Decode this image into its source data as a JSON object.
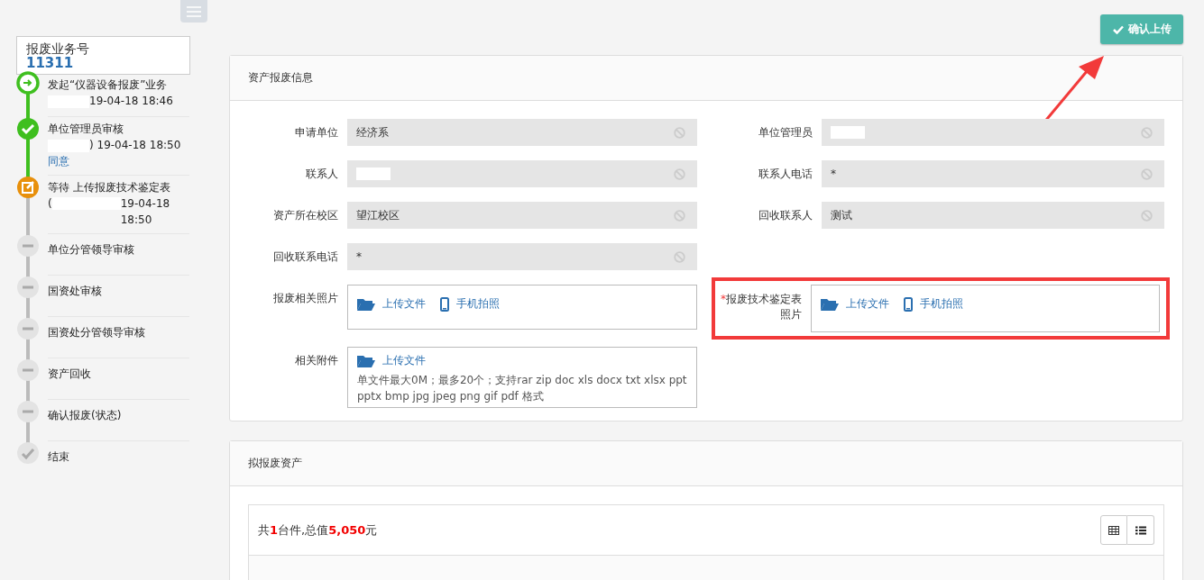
{
  "case": {
    "label": "报废业务号",
    "number": "11311"
  },
  "steps": [
    {
      "kind": "start",
      "title": "发起“仪器设备报废”业务",
      "redacted": true,
      "detail": "19-04-18 18:46"
    },
    {
      "kind": "done",
      "title": "单位管理员审核",
      "redacted": true,
      "detail": ") 19-04-18 18:50",
      "result": "同意"
    },
    {
      "kind": "current",
      "title": "等待 上传报废技术鉴定表",
      "prefix": "(",
      "redacted": true,
      "detail": "19-04-18 18:50"
    },
    {
      "kind": "pending",
      "title": "单位分管领导审核"
    },
    {
      "kind": "pending",
      "title": "国资处审核"
    },
    {
      "kind": "pending",
      "title": "国资处分管领导审核"
    },
    {
      "kind": "pending",
      "title": "资产回收"
    },
    {
      "kind": "pending",
      "title": "确认报废(状态)"
    },
    {
      "kind": "end",
      "title": "结束"
    }
  ],
  "confirm_button": {
    "label": "确认上传"
  },
  "annotation": {
    "arrow_to_button": true
  },
  "info_panel": {
    "title": "资产报废信息",
    "rows": [
      [
        {
          "kind": "text",
          "label": "申请单位",
          "value": "经济系",
          "disabled": true
        },
        {
          "kind": "text",
          "label": "单位管理员",
          "redacted": true,
          "disabled": true
        }
      ],
      [
        {
          "kind": "text",
          "label": "联系人",
          "redacted": true,
          "disabled": true
        },
        {
          "kind": "text",
          "label": "联系人电话",
          "value": "*",
          "disabled": true
        }
      ],
      [
        {
          "kind": "text",
          "label": "资产所在校区",
          "value": "望江校区",
          "disabled": true
        },
        {
          "kind": "text",
          "label": "回收联系人",
          "value": "测试",
          "disabled": true
        }
      ],
      [
        {
          "kind": "text",
          "label": "回收联系电话",
          "value": "*",
          "disabled": true
        }
      ],
      [
        {
          "kind": "upload",
          "label": "报废相关照片",
          "required": false,
          "highlighted": false,
          "upload": "上传文件",
          "camera": "手机拍照"
        },
        {
          "kind": "upload",
          "label": "报废技术鉴定表照片",
          "required": true,
          "highlighted": true,
          "upload": "上传文件",
          "camera": "手机拍照"
        }
      ],
      [
        {
          "kind": "attachment",
          "label": "相关附件",
          "upload": "上传文件",
          "note": "单文件最大0M；最多20个；支持rar zip doc xls docx txt xlsx ppt pptx bmp jpg jpeg png gif pdf 格式"
        }
      ]
    ]
  },
  "assets_panel": {
    "title": "拟报废资产",
    "summary": "共**1**台件,总值**5,050**元"
  }
}
